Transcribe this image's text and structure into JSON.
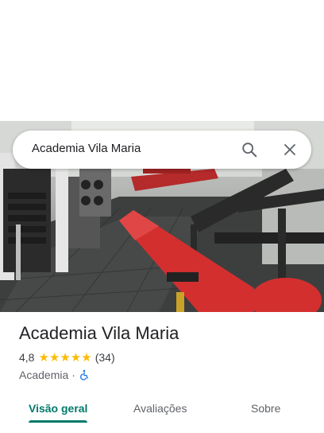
{
  "search": {
    "query": "Academia Vila Maria",
    "search_icon": "search-icon",
    "close_icon": "close-icon"
  },
  "place": {
    "name": "Academia Vila Maria",
    "rating": "4,8",
    "stars": "★★★★★",
    "review_count": "(34)",
    "category": "Academia",
    "separator": "·",
    "accessibility_icon": "wheelchair-icon"
  },
  "tabs": [
    {
      "label": "Visão geral",
      "active": true
    },
    {
      "label": "Avaliações",
      "active": false
    },
    {
      "label": "Sobre",
      "active": false
    }
  ],
  "colors": {
    "accent": "#00796b",
    "star": "#fbbc04",
    "accessibility": "#1a73e8"
  }
}
